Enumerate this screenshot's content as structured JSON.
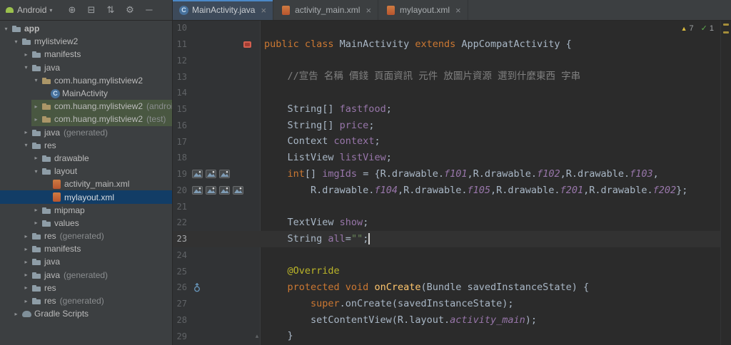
{
  "icons": {
    "close": "×",
    "caret_down": "▾",
    "chevron_down": "▾",
    "chevron_right": "▸",
    "fold_up": "▴",
    "fold_down": "▾"
  },
  "project_panel": {
    "selector_label": "Android",
    "toolbar": [
      {
        "name": "locate-file",
        "glyph": "⊕"
      },
      {
        "name": "collapse-all",
        "glyph": "⊟"
      },
      {
        "name": "sort",
        "glyph": "⇅"
      },
      {
        "name": "settings-gear",
        "glyph": "⚙"
      },
      {
        "name": "hide-panel",
        "glyph": "─"
      }
    ],
    "tree": [
      {
        "depth": 0,
        "chevron": "down",
        "icon": "folder",
        "label": "app",
        "bold": true
      },
      {
        "depth": 1,
        "chevron": "down",
        "icon": "folder",
        "label": "mylistview2"
      },
      {
        "depth": 2,
        "chevron": "right",
        "icon": "folder",
        "label": "manifests"
      },
      {
        "depth": 2,
        "chevron": "down",
        "icon": "folder",
        "label": "java"
      },
      {
        "depth": 3,
        "chevron": "down",
        "icon": "package",
        "label": "com.huang.mylistview2"
      },
      {
        "depth": 4,
        "icon": "class",
        "label": "MainActivity"
      },
      {
        "depth": 3,
        "chevron": "right",
        "icon": "package",
        "label": "com.huang.mylistview2",
        "suffix": "(androidTest)",
        "highlight": "green"
      },
      {
        "depth": 3,
        "chevron": "right",
        "icon": "package",
        "label": "com.huang.mylistview2",
        "suffix": "(test)",
        "highlight": "green"
      },
      {
        "depth": 2,
        "chevron": "right",
        "icon": "folder",
        "label": "java",
        "suffix": "(generated)"
      },
      {
        "depth": 2,
        "chevron": "down",
        "icon": "folder",
        "label": "res"
      },
      {
        "depth": 3,
        "chevron": "right",
        "icon": "folder",
        "label": "drawable"
      },
      {
        "depth": 3,
        "chevron": "down",
        "icon": "folder",
        "label": "layout"
      },
      {
        "depth": 4,
        "icon": "xml",
        "label": "activity_main.xml"
      },
      {
        "depth": 4,
        "icon": "xml",
        "label": "mylayout.xml",
        "highlight": "blue"
      },
      {
        "depth": 3,
        "chevron": "right",
        "icon": "folder",
        "label": "mipmap"
      },
      {
        "depth": 3,
        "chevron": "right",
        "icon": "folder",
        "label": "values"
      },
      {
        "depth": 2,
        "chevron": "right",
        "icon": "folder",
        "label": "res",
        "suffix": "(generated)"
      },
      {
        "depth": 2,
        "chevron": "right",
        "icon": "folder",
        "label": "manifests"
      },
      {
        "depth": 2,
        "chevron": "right",
        "icon": "folder",
        "label": "java"
      },
      {
        "depth": 2,
        "chevron": "right",
        "icon": "folder",
        "label": "java",
        "suffix": "(generated)"
      },
      {
        "depth": 2,
        "chevron": "right",
        "icon": "folder",
        "label": "res"
      },
      {
        "depth": 2,
        "chevron": "right",
        "icon": "folder",
        "label": "res",
        "suffix": "(generated)"
      },
      {
        "depth": 1,
        "chevron": "right",
        "icon": "gradle",
        "label": "Gradle Scripts"
      }
    ]
  },
  "tabs": [
    {
      "label": "MainActivity.java",
      "icon": "class",
      "active": true
    },
    {
      "label": "activity_main.xml",
      "icon": "xml",
      "active": false
    },
    {
      "label": "mylayout.xml",
      "icon": "xml",
      "active": false
    }
  ],
  "editor": {
    "inspections": {
      "warning_glyph": "▲",
      "warnings": "7",
      "ok_glyph": "✓",
      "ok": "1"
    },
    "caret_line": "23",
    "lines": [
      {
        "n": "10"
      },
      {
        "n": "11",
        "gutter_right": [
          "related-activity"
        ],
        "code": [
          [
            "kw",
            "public class "
          ],
          [
            "plain",
            "MainActivity "
          ],
          [
            "kw",
            "extends "
          ],
          [
            "plain",
            "AppCompatActivity {"
          ]
        ]
      },
      {
        "n": "12"
      },
      {
        "n": "13",
        "code": [
          [
            "cmt",
            "    //宣告 名稱 價錢 頁面資訊 元件 放圖片資源 選到什麼東西 字串"
          ]
        ]
      },
      {
        "n": "14"
      },
      {
        "n": "15",
        "code": [
          [
            "plain",
            "    String[] "
          ],
          [
            "field",
            "fastfood"
          ],
          [
            "plain",
            ";"
          ]
        ]
      },
      {
        "n": "16",
        "code": [
          [
            "plain",
            "    String[] "
          ],
          [
            "field",
            "price"
          ],
          [
            "plain",
            ";"
          ]
        ]
      },
      {
        "n": "17",
        "code": [
          [
            "plain",
            "    Context "
          ],
          [
            "field",
            "context"
          ],
          [
            "plain",
            ";"
          ]
        ]
      },
      {
        "n": "18",
        "code": [
          [
            "plain",
            "    ListView "
          ],
          [
            "field",
            "listView"
          ],
          [
            "plain",
            ";"
          ]
        ]
      },
      {
        "n": "19",
        "gutter": [
          "image",
          "image",
          "image"
        ],
        "code": [
          [
            "plain",
            "    "
          ],
          [
            "kw",
            "int"
          ],
          [
            "plain",
            "[] "
          ],
          [
            "field",
            "imgIds"
          ],
          [
            "plain",
            " = {R.drawable."
          ],
          [
            "fieldi",
            "f101"
          ],
          [
            "plain",
            ",R.drawable."
          ],
          [
            "fieldi",
            "f102"
          ],
          [
            "plain",
            ",R.drawable."
          ],
          [
            "fieldi",
            "f103"
          ],
          [
            "plain",
            ","
          ]
        ]
      },
      {
        "n": "20",
        "gutter": [
          "image",
          "image",
          "image",
          "image"
        ],
        "code": [
          [
            "plain",
            "        R.drawable."
          ],
          [
            "fieldi",
            "f104"
          ],
          [
            "plain",
            ",R.drawable."
          ],
          [
            "fieldi",
            "f105"
          ],
          [
            "plain",
            ",R.drawable."
          ],
          [
            "fieldi",
            "f201"
          ],
          [
            "plain",
            ",R.drawable."
          ],
          [
            "fieldi",
            "f202"
          ],
          [
            "plain",
            "};"
          ]
        ]
      },
      {
        "n": "21"
      },
      {
        "n": "22",
        "code": [
          [
            "plain",
            "    TextView "
          ],
          [
            "field",
            "show"
          ],
          [
            "plain",
            ";"
          ]
        ]
      },
      {
        "n": "23",
        "caret": true,
        "code": [
          [
            "plain",
            "    String "
          ],
          [
            "field",
            "all"
          ],
          [
            "plain",
            "="
          ],
          [
            "str",
            "\"\""
          ],
          [
            "plain",
            ";"
          ]
        ]
      },
      {
        "n": "24"
      },
      {
        "n": "25",
        "code": [
          [
            "ann",
            "    @Override"
          ]
        ]
      },
      {
        "n": "26",
        "gutter": [
          "override"
        ],
        "code": [
          [
            "plain",
            "    "
          ],
          [
            "kw",
            "protected void "
          ],
          [
            "mth",
            "onCreate"
          ],
          [
            "plain",
            "(Bundle savedInstanceState) {"
          ]
        ]
      },
      {
        "n": "27",
        "code": [
          [
            "plain",
            "        "
          ],
          [
            "kw",
            "super"
          ],
          [
            "plain",
            ".onCreate(savedInstanceState);"
          ]
        ]
      },
      {
        "n": "28",
        "code": [
          [
            "plain",
            "        setContentView(R.layout."
          ],
          [
            "fieldi",
            "activity_main"
          ],
          [
            "plain",
            ");"
          ]
        ]
      },
      {
        "n": "29",
        "fold": "up",
        "code": [
          [
            "plain",
            "    }"
          ]
        ]
      }
    ]
  }
}
